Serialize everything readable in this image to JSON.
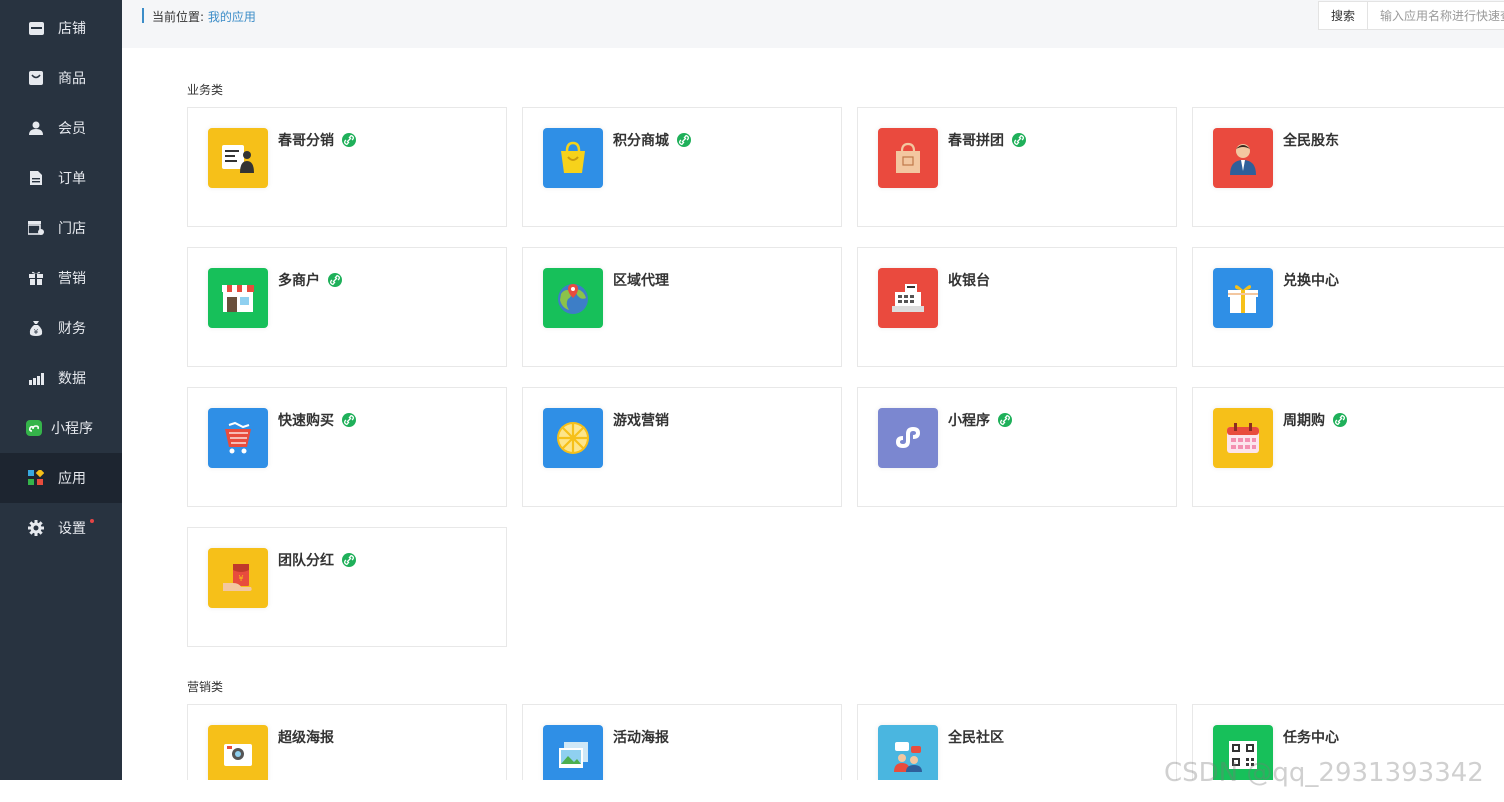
{
  "sidebar": {
    "items": [
      {
        "label": "店铺",
        "icon": "store-icon"
      },
      {
        "label": "商品",
        "icon": "goods-icon"
      },
      {
        "label": "会员",
        "icon": "member-icon"
      },
      {
        "label": "订单",
        "icon": "order-icon"
      },
      {
        "label": "门店",
        "icon": "shop-icon"
      },
      {
        "label": "营销",
        "icon": "gift-icon"
      },
      {
        "label": "财务",
        "icon": "money-bag-icon"
      },
      {
        "label": "数据",
        "icon": "chart-icon"
      },
      {
        "label": "小程序",
        "icon": "miniprogram-icon"
      },
      {
        "label": "应用",
        "icon": "apps-icon",
        "active": true
      },
      {
        "label": "设置",
        "icon": "gear-icon",
        "badge": true
      }
    ]
  },
  "breadcrumb": {
    "prefix": "当前位置:",
    "current": "我的应用"
  },
  "search": {
    "button": "搜索",
    "placeholder": "输入应用名称进行快速查找"
  },
  "sections": [
    {
      "title": "业务类",
      "apps": [
        {
          "name": "春哥分销",
          "linked": true,
          "color": "#f6c019",
          "icon": "distribution-icon"
        },
        {
          "name": "积分商城",
          "linked": true,
          "color": "#2f8fe6",
          "icon": "shopping-bag-icon"
        },
        {
          "name": "春哥拼团",
          "linked": true,
          "color": "#ea4a3e",
          "icon": "group-buy-bag-icon"
        },
        {
          "name": "全民股东",
          "linked": false,
          "color": "#ea4a3e",
          "icon": "shareholder-person-icon"
        },
        {
          "name": "多商户",
          "linked": true,
          "color": "#17c05a",
          "icon": "storefront-icon"
        },
        {
          "name": "区域代理",
          "linked": false,
          "color": "#17c05a",
          "icon": "globe-pin-icon"
        },
        {
          "name": "收银台",
          "linked": false,
          "color": "#ea4a3e",
          "icon": "cash-register-icon"
        },
        {
          "name": "兑换中心",
          "linked": false,
          "color": "#2f8fe6",
          "icon": "gift-box-icon"
        },
        {
          "name": "快速购买",
          "linked": true,
          "color": "#2f8fe6",
          "icon": "shopping-cart-icon"
        },
        {
          "name": "游戏营销",
          "linked": false,
          "color": "#2f8fe6",
          "icon": "wheel-icon"
        },
        {
          "name": "小程序",
          "linked": true,
          "color": "#7b87d0",
          "icon": "miniprogram-logo-icon"
        },
        {
          "name": "周期购",
          "linked": true,
          "color": "#f6c019",
          "icon": "calendar-icon"
        },
        {
          "name": "团队分红",
          "linked": true,
          "color": "#f6c019",
          "icon": "red-envelope-icon"
        }
      ]
    },
    {
      "title": "营销类",
      "apps": [
        {
          "name": "超级海报",
          "linked": false,
          "color": "#f6c019",
          "icon": "poster-camera-icon"
        },
        {
          "name": "活动海报",
          "linked": false,
          "color": "#2f8fe6",
          "icon": "photo-icon"
        },
        {
          "name": "全民社区",
          "linked": false,
          "color": "#4ab6e0",
          "icon": "community-people-icon"
        },
        {
          "name": "任务中心",
          "linked": false,
          "color": "#17c05a",
          "icon": "qr-code-icon"
        }
      ]
    }
  ],
  "watermark": "CSDN @qq_2931393342"
}
